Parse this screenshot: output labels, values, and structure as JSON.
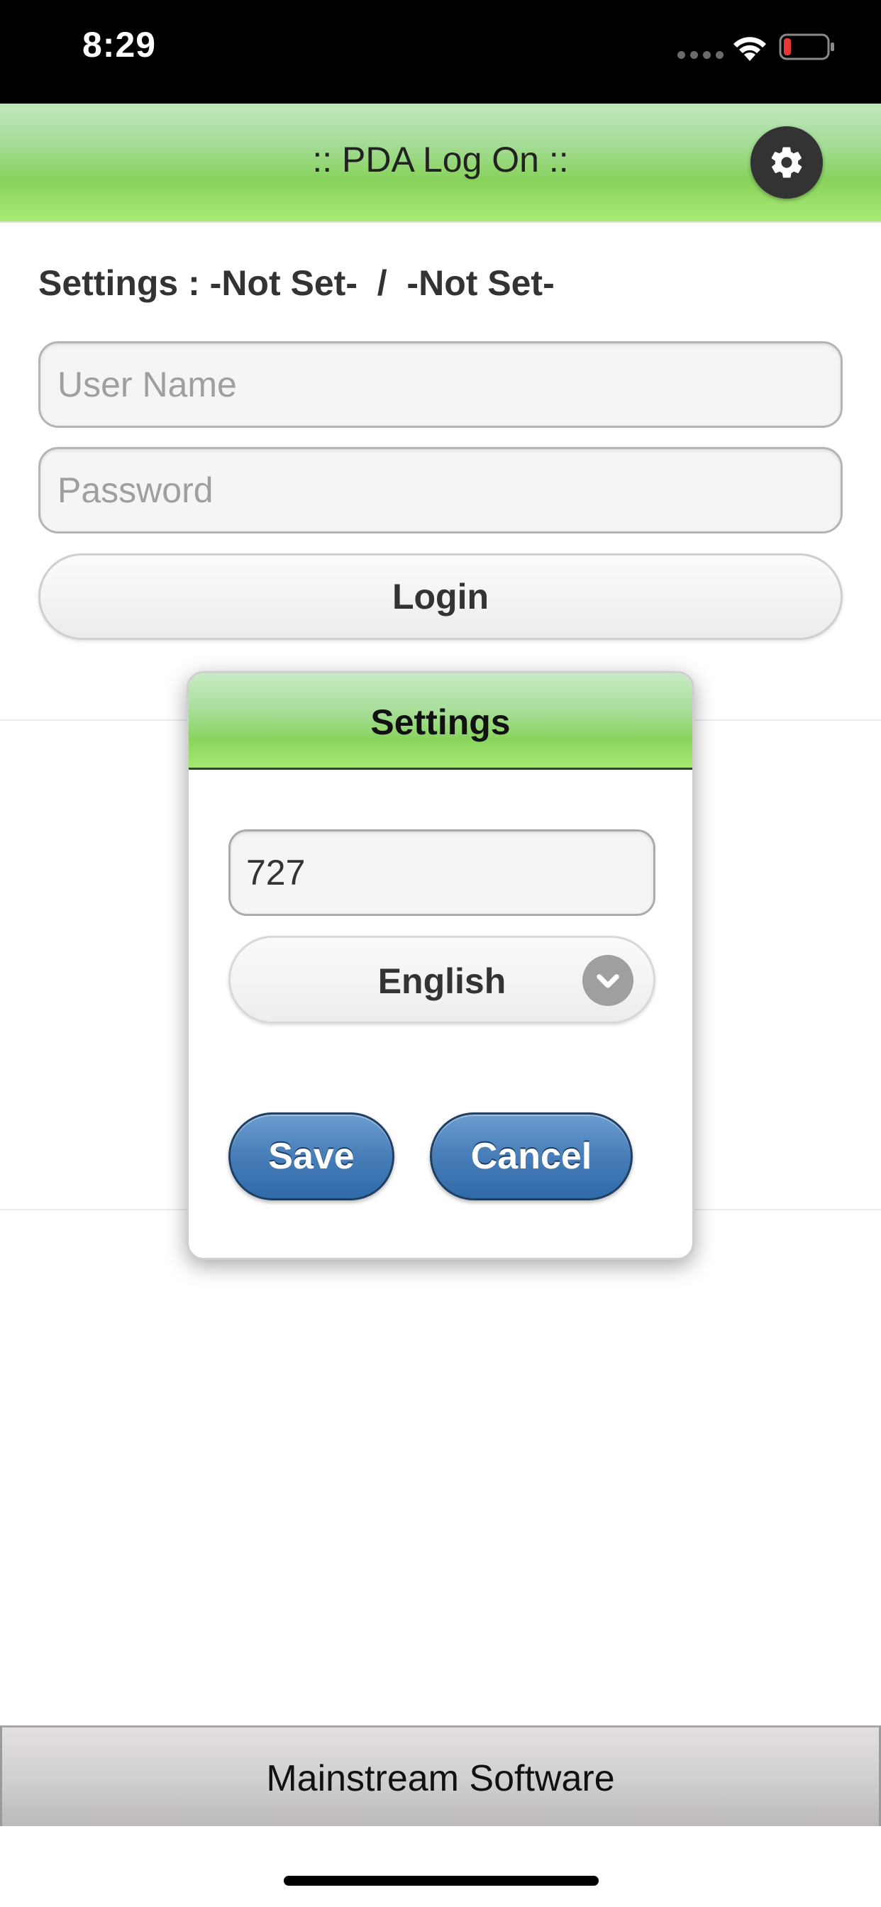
{
  "status_bar": {
    "time": "8:29",
    "icons": [
      "signal-dots-icon",
      "wifi-icon",
      "battery-low-icon"
    ],
    "battery_color": "#e53935"
  },
  "header": {
    "title": ":: PDA Log On ::",
    "settings_icon": "gear-icon",
    "gradient_color": "#88d25c"
  },
  "main": {
    "settings_line": "Settings : -Not Set-  /  -Not Set-",
    "username_placeholder": "User Name",
    "password_placeholder": "Password",
    "login_label": "Login"
  },
  "dialog": {
    "title": "Settings",
    "field_value": "727",
    "language_selected": "English",
    "save_label": "Save",
    "cancel_label": "Cancel",
    "button_color": "#4a80ba"
  },
  "footer": {
    "text": "Mainstream Software"
  }
}
